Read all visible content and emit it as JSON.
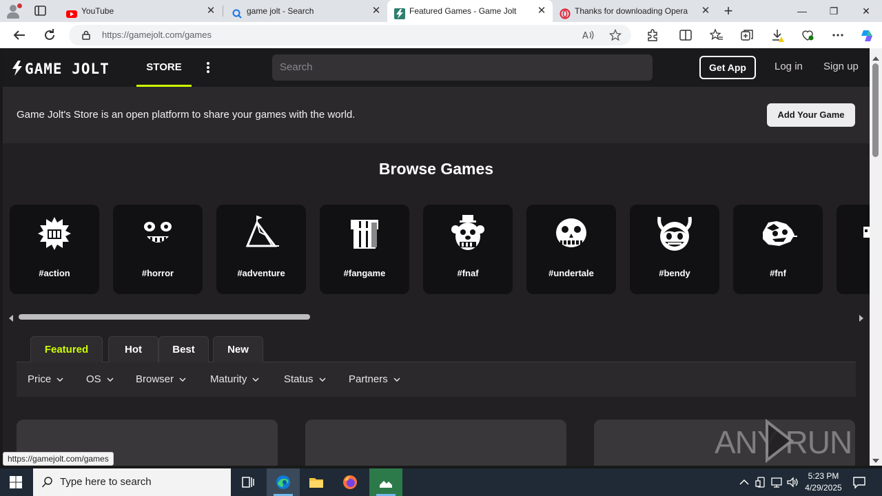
{
  "browser": {
    "tabs": [
      {
        "title": "YouTube",
        "active": false
      },
      {
        "title": "game jolt - Search",
        "active": false
      },
      {
        "title": "Featured Games - Game Jolt",
        "active": true
      },
      {
        "title": "Thanks for downloading Opera",
        "active": false
      }
    ],
    "url": "https://gamejolt.com/games",
    "status_url": "https://gamejolt.com/games"
  },
  "site": {
    "logo_text": "GAME JOLT",
    "nav_store": "STORE",
    "search_placeholder": "Search",
    "get_app": "Get App",
    "login": "Log in",
    "signup": "Sign up",
    "banner_text": "Game Jolt's Store is an open platform to share your games with the world.",
    "add_game": "Add Your Game",
    "browse_title": "Browse Games",
    "accent_color": "#ccff00",
    "tags": [
      {
        "label": "#action",
        "icon": "action-icon"
      },
      {
        "label": "#horror",
        "icon": "horror-icon"
      },
      {
        "label": "#adventure",
        "icon": "adventure-icon"
      },
      {
        "label": "#fangame",
        "icon": "fangame-icon"
      },
      {
        "label": "#fnaf",
        "icon": "fnaf-icon"
      },
      {
        "label": "#undertale",
        "icon": "undertale-icon"
      },
      {
        "label": "#bendy",
        "icon": "bendy-icon"
      },
      {
        "label": "#fnf",
        "icon": "fnf-icon"
      }
    ],
    "feed_tabs": [
      {
        "label": "Featured",
        "active": true
      },
      {
        "label": "Hot",
        "active": false
      },
      {
        "label": "Best",
        "active": false
      },
      {
        "label": "New",
        "active": false
      }
    ],
    "filters": [
      "Price",
      "OS",
      "Browser",
      "Maturity",
      "Status",
      "Partners"
    ]
  },
  "watermark": "ANY RUN",
  "taskbar": {
    "search_placeholder": "Type here to search",
    "time": "5:23 PM",
    "date": "4/29/2025"
  }
}
